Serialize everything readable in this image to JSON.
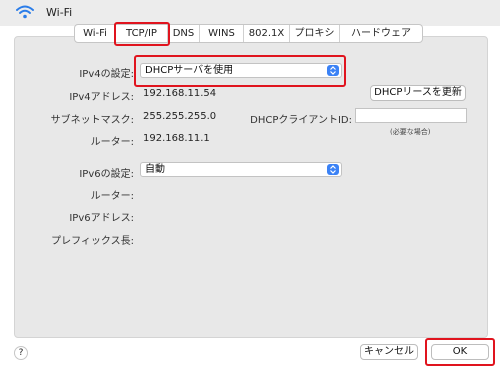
{
  "window": {
    "title": "Wi-Fi"
  },
  "tabs": [
    "Wi-Fi",
    "TCP/IP",
    "DNS",
    "WINS",
    "802.1X",
    "プロキシ",
    "ハードウェア"
  ],
  "ipv4": {
    "config_label": "IPv4の設定:",
    "config_value": "DHCPサーバを使用",
    "address_label": "IPv4アドレス:",
    "address_value": "192.168.11.54",
    "subnet_label": "サブネットマスク:",
    "subnet_value": "255.255.255.0",
    "router_label": "ルーター:",
    "router_value": "192.168.11.1",
    "renew_button": "DHCPリースを更新",
    "client_id_label": "DHCPクライアントID:",
    "client_id_value": "",
    "client_id_hint": "(必要な場合)"
  },
  "ipv6": {
    "config_label": "IPv6の設定:",
    "config_value": "自動",
    "router_label": "ルーター:",
    "address_label": "IPv6アドレス:",
    "prefix_label": "プレフィックス長:"
  },
  "footer": {
    "help": "?",
    "cancel_button": "キャンセル",
    "ok_button": "OK"
  },
  "colors": {
    "highlight": "#e0141e",
    "select_accent": "#3b82f6"
  }
}
